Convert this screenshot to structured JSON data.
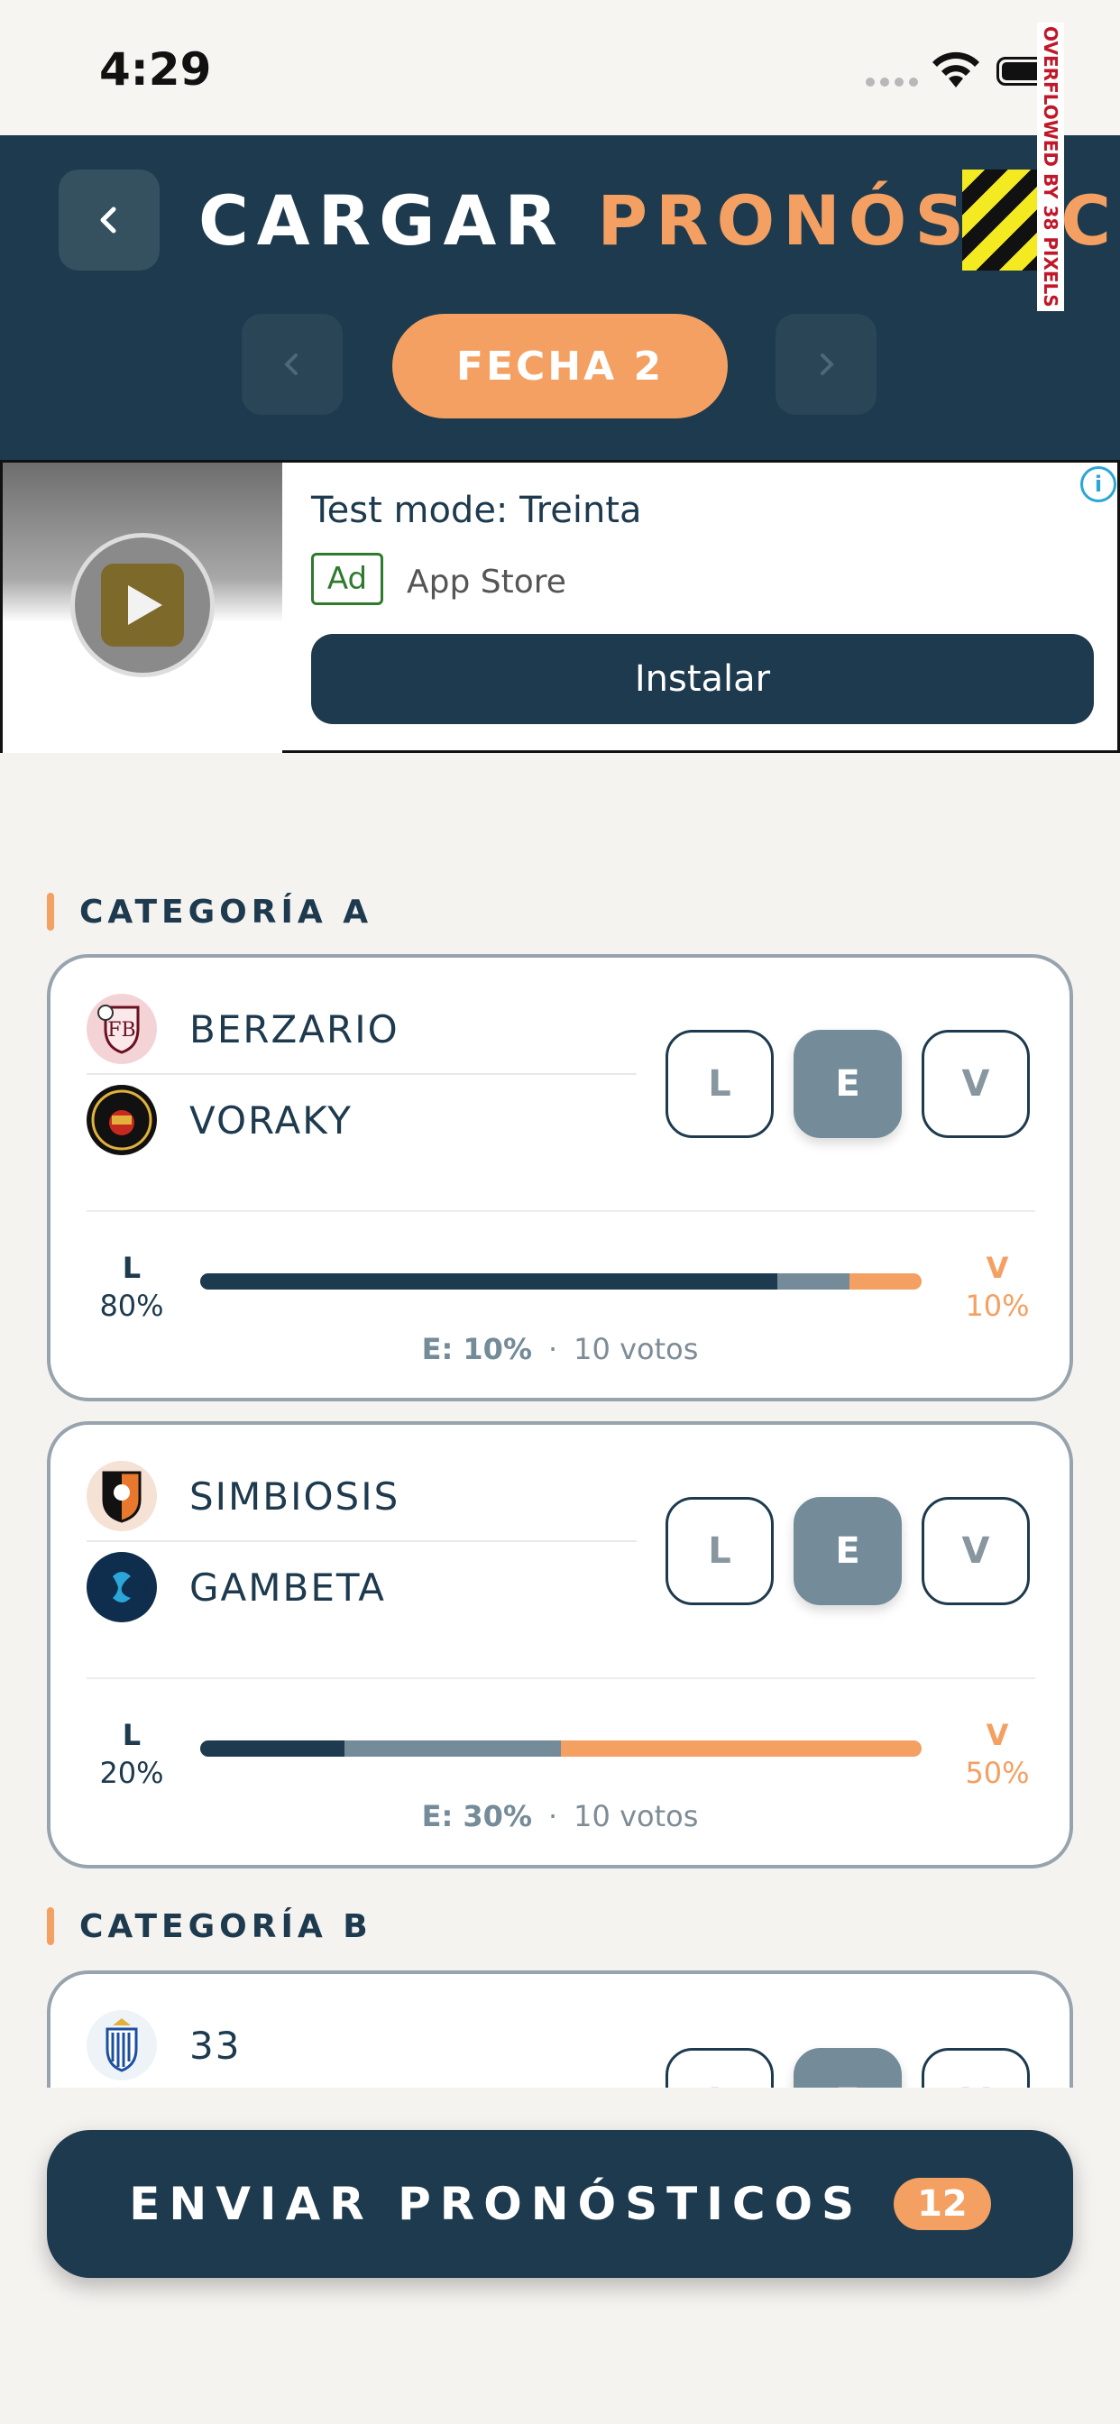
{
  "status": {
    "time": "4:29"
  },
  "overflow_warning": "OVERFLOWED BY 38 PIXELS",
  "header": {
    "title_white": "CARGAR",
    "title_orange": "PRONÓSTICO",
    "fecha": "FECHA 2"
  },
  "ad": {
    "title": "Test mode: Treinta",
    "badge": "Ad",
    "store": "App Store",
    "install": "Instalar",
    "info": "i"
  },
  "categories": [
    {
      "label": "CATEGORÍA A",
      "matches": [
        {
          "home": "BERZARIO",
          "away": "VORAKY",
          "choices": [
            "L",
            "E",
            "V"
          ],
          "selected": "E",
          "pct_l_label": "L",
          "pct_l": "80%",
          "pct_v_label": "V",
          "pct_v": "10%",
          "pct_e": "E: 10%",
          "votes": "10 votos",
          "dist": [
            0.8,
            0.1,
            0.1
          ]
        },
        {
          "home": "SIMBIOSIS",
          "away": "GAMBETA",
          "choices": [
            "L",
            "E",
            "V"
          ],
          "selected": "E",
          "pct_l_label": "L",
          "pct_l": "20%",
          "pct_v_label": "V",
          "pct_v": "50%",
          "pct_e": "E: 30%",
          "votes": "10 votos",
          "dist": [
            0.2,
            0.3,
            0.5
          ]
        }
      ]
    },
    {
      "label": "CATEGORÍA B",
      "matches": [
        {
          "home": "33",
          "choices": [
            "L",
            "E",
            "V"
          ],
          "selected": "E"
        }
      ]
    }
  ],
  "footer": {
    "send_label": "ENVIAR PRONÓSTICOS",
    "count": "12"
  },
  "colors": {
    "navy": "#1d3a4e",
    "orange": "#f4a062",
    "slate": "#748b99"
  }
}
